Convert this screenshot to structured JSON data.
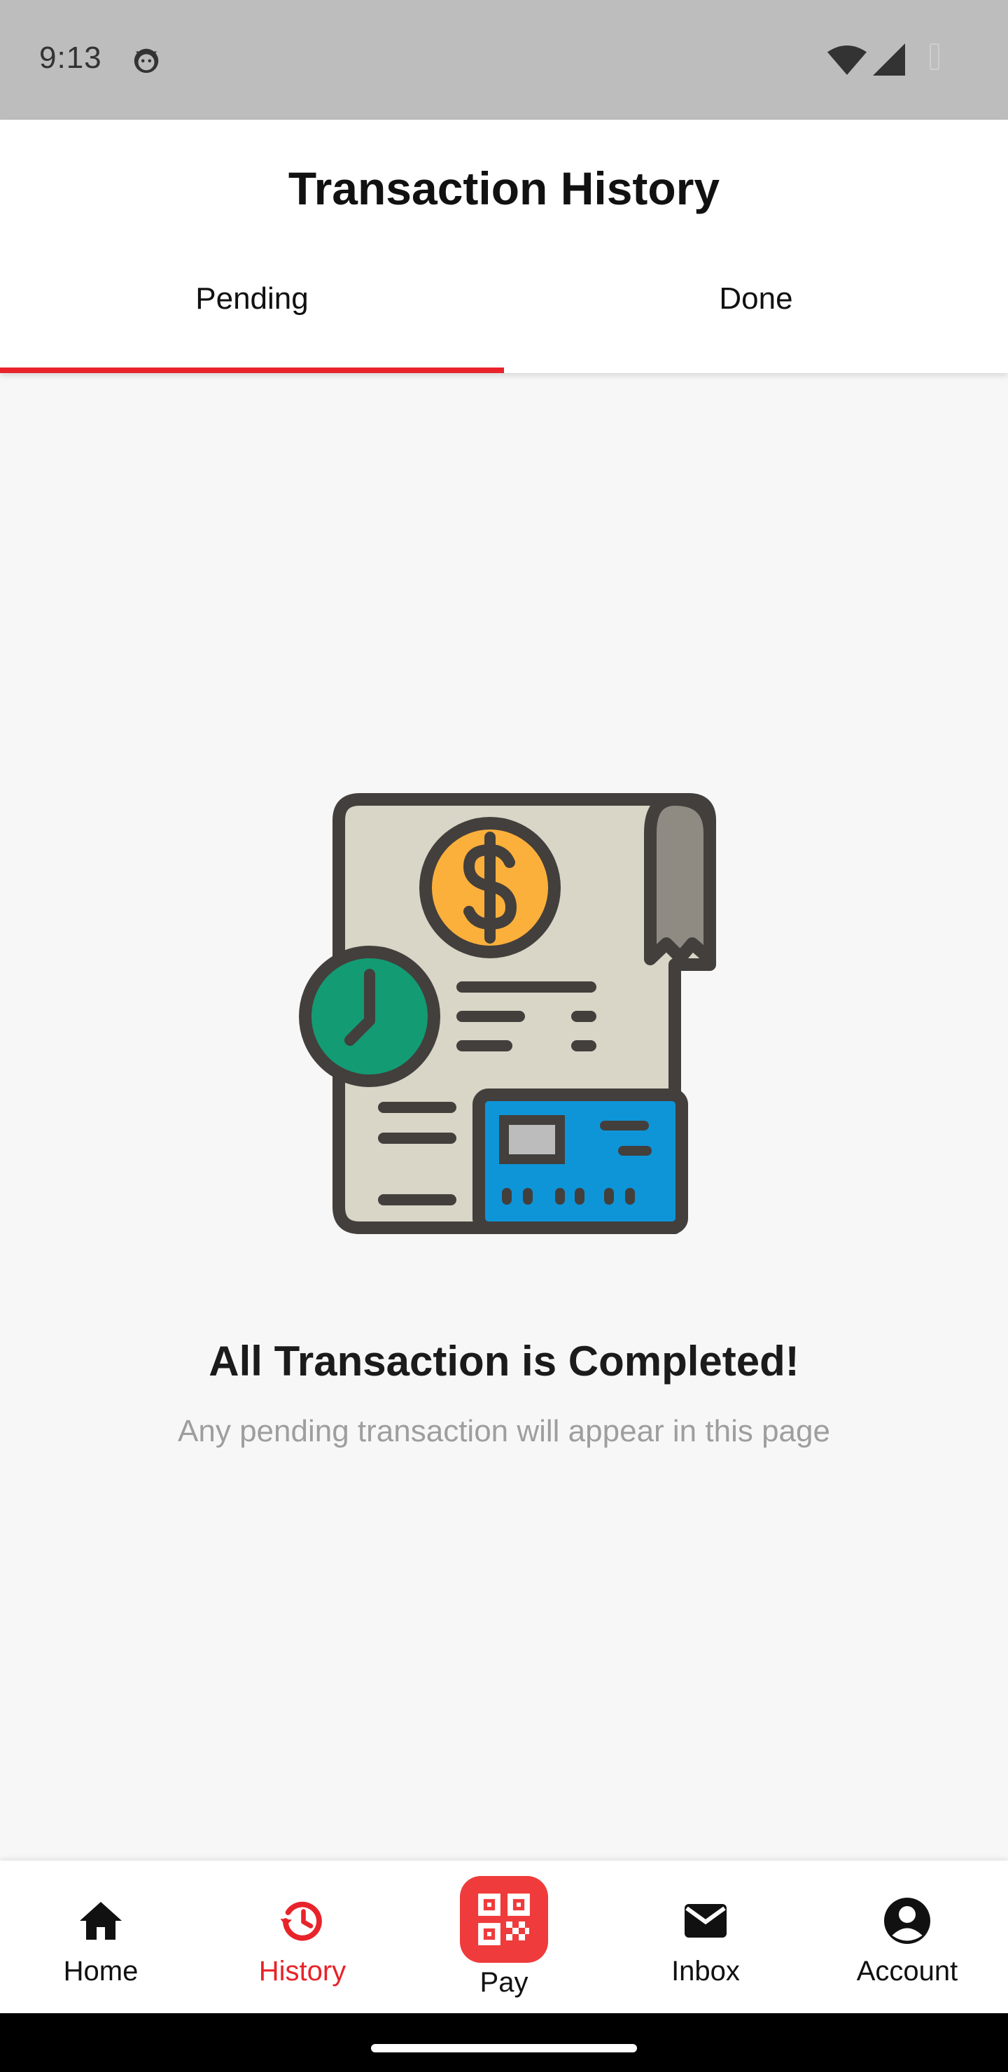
{
  "status_bar": {
    "time": "9:13"
  },
  "header": {
    "title": "Transaction History",
    "tabs": [
      {
        "label": "Pending",
        "selected": true
      },
      {
        "label": "Done",
        "selected": false
      }
    ]
  },
  "empty_state": {
    "illustration": "receipt-clock-card-illustration",
    "title": "All Transaction is Completed!",
    "subtitle": "Any pending transaction will appear in this page"
  },
  "bottom_nav": {
    "items": [
      {
        "label": "Home",
        "icon": "home-icon",
        "active": false
      },
      {
        "label": "History",
        "icon": "history-icon",
        "active": true
      },
      {
        "label": "Pay",
        "icon": "qr-code-icon",
        "active": false
      },
      {
        "label": "Inbox",
        "icon": "mail-icon",
        "active": false
      },
      {
        "label": "Account",
        "icon": "account-icon",
        "active": false
      }
    ]
  },
  "colors": {
    "accent": "#e8232a",
    "pay_button": "#ef3b3b",
    "status_bar": "#bdbdbd",
    "background": "#f7f7f7"
  }
}
